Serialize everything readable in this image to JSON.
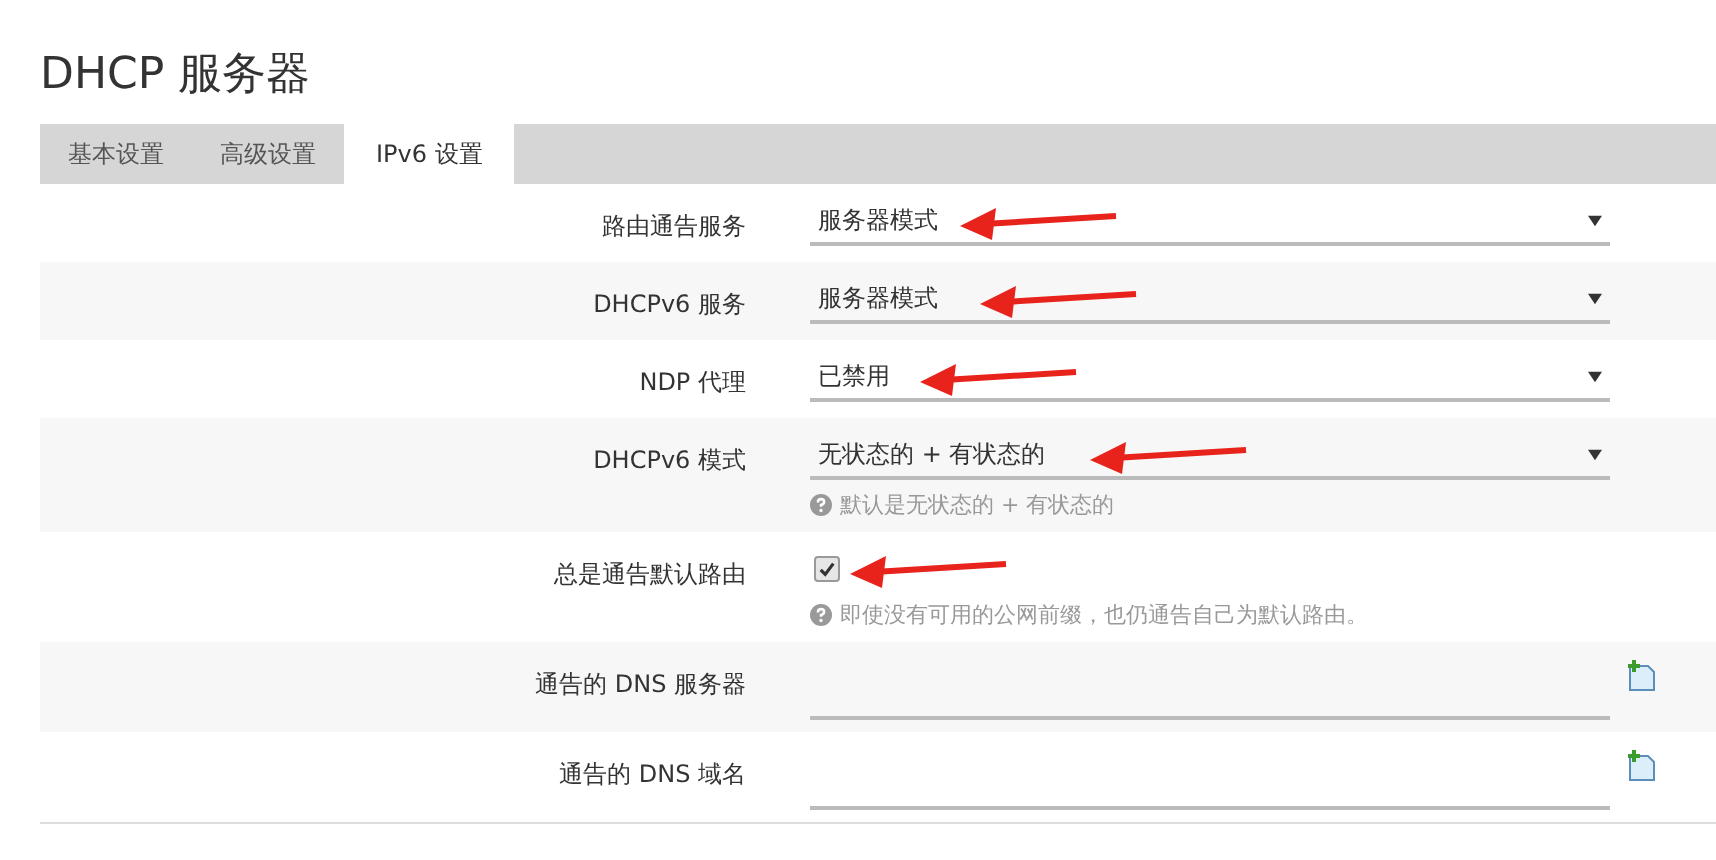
{
  "title": "DHCP 服务器",
  "tabs": [
    {
      "label": "基本设置",
      "selected": false
    },
    {
      "label": "高级设置",
      "selected": false
    },
    {
      "label": "IPv6 设置",
      "selected": true
    }
  ],
  "rows": [
    {
      "kind": "select",
      "label": "路由通告服务",
      "value": "服务器模式",
      "arrow": true
    },
    {
      "kind": "select",
      "label": "DHCPv6 服务",
      "value": "服务器模式",
      "arrow": true
    },
    {
      "kind": "select",
      "label": "NDP 代理",
      "value": "已禁用",
      "arrow": true
    },
    {
      "kind": "select",
      "label": "DHCPv6 模式",
      "value": "无状态的 + 有状态的",
      "arrow": true,
      "hint": "默认是无状态的 + 有状态的"
    },
    {
      "kind": "checkbox",
      "label": "总是通告默认路由",
      "checked": true,
      "arrow": true,
      "hint": "即使没有可用的公网前缀，也仍通告自己为默认路由。"
    },
    {
      "kind": "list",
      "label": "通告的 DNS 服务器",
      "arrow": false
    },
    {
      "kind": "list",
      "label": "通告的 DNS 域名",
      "arrow": false
    }
  ]
}
